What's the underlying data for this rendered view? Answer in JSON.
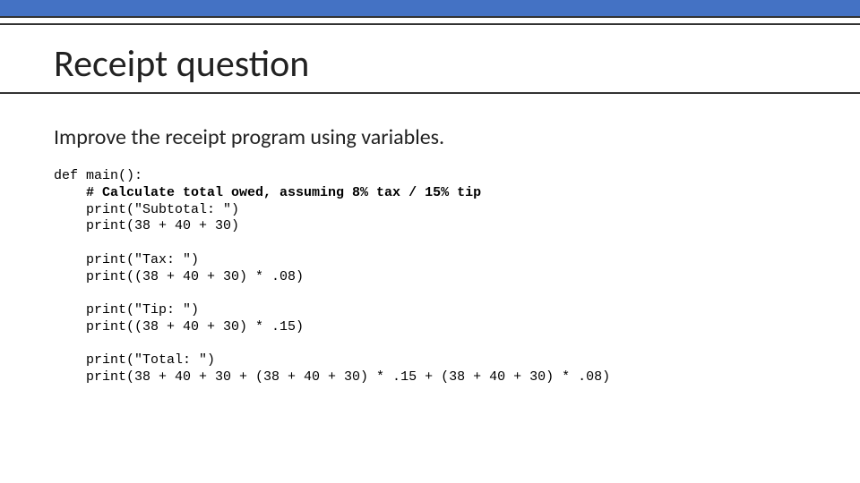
{
  "title": "Receipt question",
  "prompt": "Improve the receipt program using variables.",
  "code": {
    "l1": "def main():",
    "l2": "    # Calculate total owed, assuming 8% tax / 15% tip",
    "l3": "    print(\"Subtotal: \")",
    "l4": "    print(38 + 40 + 30)",
    "l5": "",
    "l6": "    print(\"Tax: \")",
    "l7": "    print((38 + 40 + 30) * .08)",
    "l8": "",
    "l9": "    print(\"Tip: \")",
    "l10": "    print((38 + 40 + 30) * .15)",
    "l11": "",
    "l12": "    print(\"Total: \")",
    "l13": "    print(38 + 40 + 30 + (38 + 40 + 30) * .15 + (38 + 40 + 30) * .08)"
  }
}
